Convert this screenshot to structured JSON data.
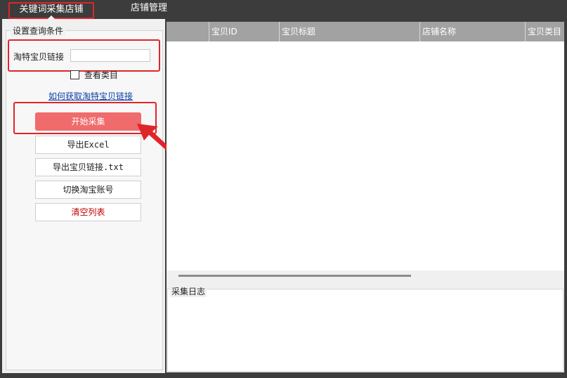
{
  "tabs": [
    {
      "label": "关键词采集店铺",
      "active": true
    },
    {
      "label": "店铺管理",
      "active": false
    }
  ],
  "left_panel": {
    "group_title": "设置查询条件",
    "link_label": "淘特宝贝链接",
    "link_input_value": "",
    "view_category_label": "查看类目",
    "view_category_checked": false,
    "help_link": "如何获取淘特宝贝链接",
    "buttons": {
      "start": "开始采集",
      "export_excel": "导出Excel",
      "export_links": "导出宝贝链接.txt",
      "switch_account": "切换淘宝账号",
      "clear_list": "清空列表"
    }
  },
  "table": {
    "columns": [
      "",
      "宝贝ID",
      "宝贝标题",
      "店铺名称",
      "宝贝类目"
    ],
    "rows": []
  },
  "log": {
    "title": "采集日志",
    "content": ""
  },
  "colors": {
    "highlight": "#e0252a",
    "start_button": "#f06b6b",
    "clear_text": "#c00000",
    "header_bg": "#a2a2a2",
    "link": "#0a3fa8"
  }
}
